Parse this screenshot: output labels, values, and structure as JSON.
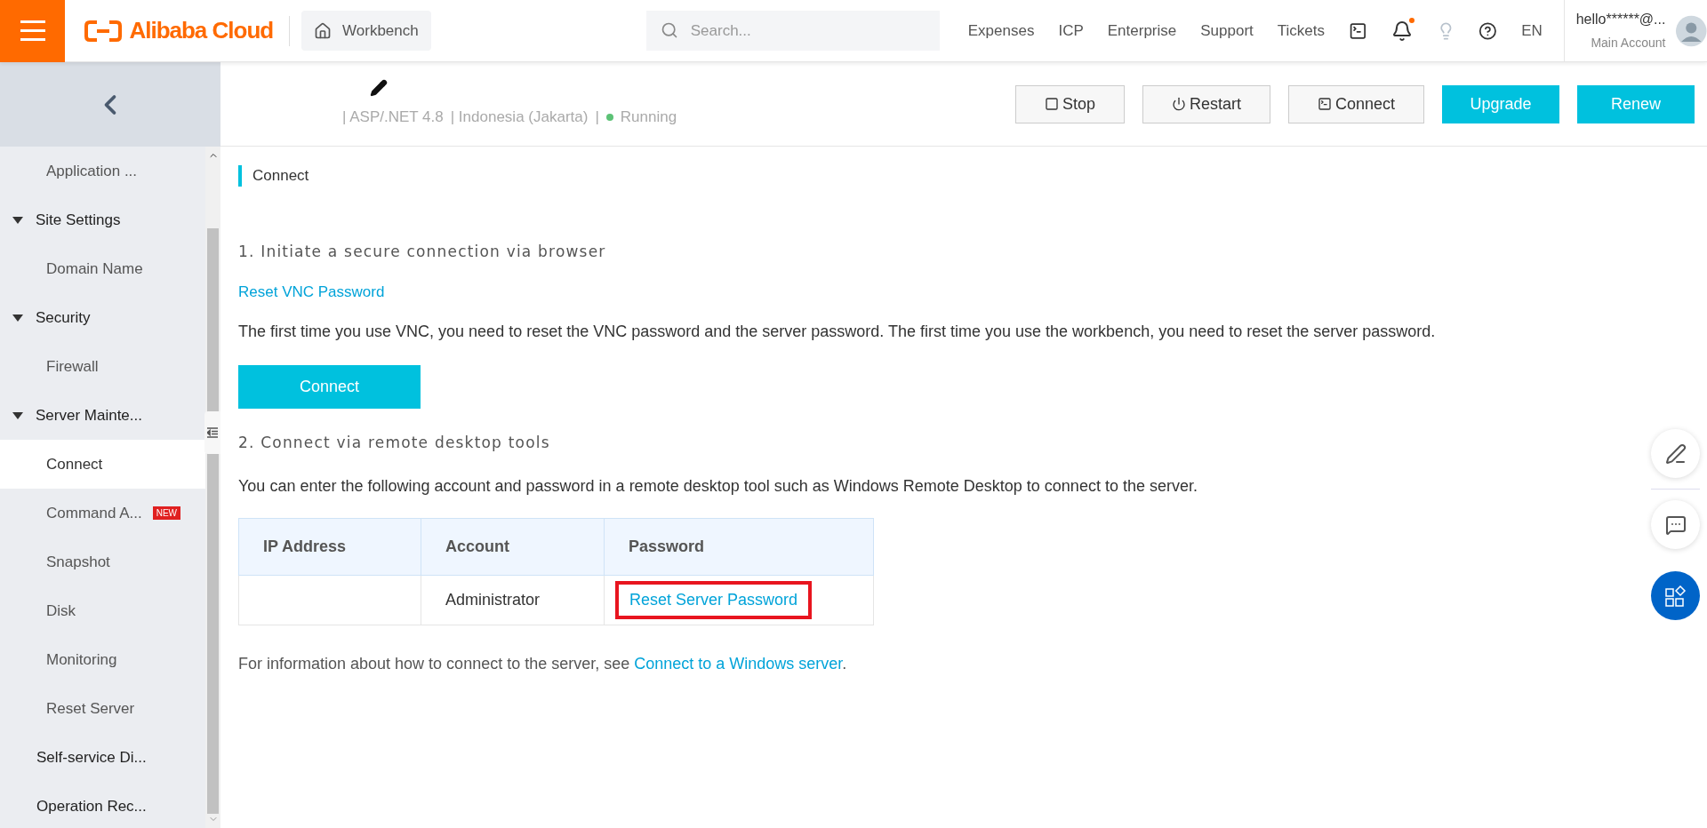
{
  "topbar": {
    "logo": "Alibaba Cloud",
    "workbench": "Workbench",
    "search": {
      "placeholder": "Search..."
    },
    "nav": [
      "Expenses",
      "ICP",
      "Enterprise",
      "Support",
      "Tickets"
    ],
    "notification_dot": true,
    "language": "EN",
    "user": {
      "name": "hello******@...",
      "role": "Main Account"
    }
  },
  "sidebar": {
    "items": [
      {
        "label": "Application ...",
        "kind": "leaf",
        "selected": false
      },
      {
        "label": "Site Settings",
        "kind": "group",
        "expanded": true,
        "children": [
          {
            "label": "Domain Name",
            "selected": false
          }
        ]
      },
      {
        "label": "Security",
        "kind": "group",
        "expanded": true,
        "children": [
          {
            "label": "Firewall",
            "selected": false
          }
        ]
      },
      {
        "label": "Server Mainte...",
        "kind": "group",
        "expanded": true,
        "children": [
          {
            "label": "Connect",
            "selected": true
          },
          {
            "label": "Command A...",
            "selected": false,
            "badge": "NEW"
          },
          {
            "label": "Snapshot",
            "selected": false
          },
          {
            "label": "Disk",
            "selected": false
          },
          {
            "label": "Monitoring",
            "selected": false
          },
          {
            "label": "Reset Server",
            "selected": false
          }
        ]
      },
      {
        "label": "Self-service Di...",
        "kind": "top",
        "selected": false
      },
      {
        "label": "Operation Rec...",
        "kind": "top",
        "selected": false
      }
    ]
  },
  "header": {
    "status_parts": [
      "| ASP/.NET 4.8",
      "| Indonesia (Jakarta)",
      "|"
    ],
    "status": "Running",
    "running": true,
    "buttons": [
      {
        "label": "Stop",
        "kind": "stop"
      },
      {
        "label": "Restart",
        "kind": "restart"
      },
      {
        "label": "Connect",
        "kind": "connect"
      },
      {
        "label": "Upgrade",
        "kind": "primary"
      },
      {
        "label": "Renew",
        "kind": "primary"
      }
    ]
  },
  "content": {
    "title": "Connect",
    "section1": {
      "heading": "1. Initiate a secure connection via browser",
      "link": "Reset VNC Password",
      "text": "The first time you use VNC, you need to reset the VNC password and the server password. The first time you use the workbench, you need to reset the server password.",
      "button": "Connect"
    },
    "section2": {
      "heading": "2. Connect via remote desktop tools",
      "text": "You can enter the following account and password in a remote desktop tool such as Windows Remote Desktop to connect to the server.",
      "table": {
        "columns": [
          "IP Address",
          "Account",
          "Password"
        ],
        "rows": [
          {
            "account": "Administrator",
            "password_link": "Reset Server Password",
            "highlighted": true
          }
        ]
      }
    },
    "footer": {
      "text": "For information about how to connect to the server, see ",
      "link": "Connect to a Windows server",
      "end": "."
    }
  }
}
